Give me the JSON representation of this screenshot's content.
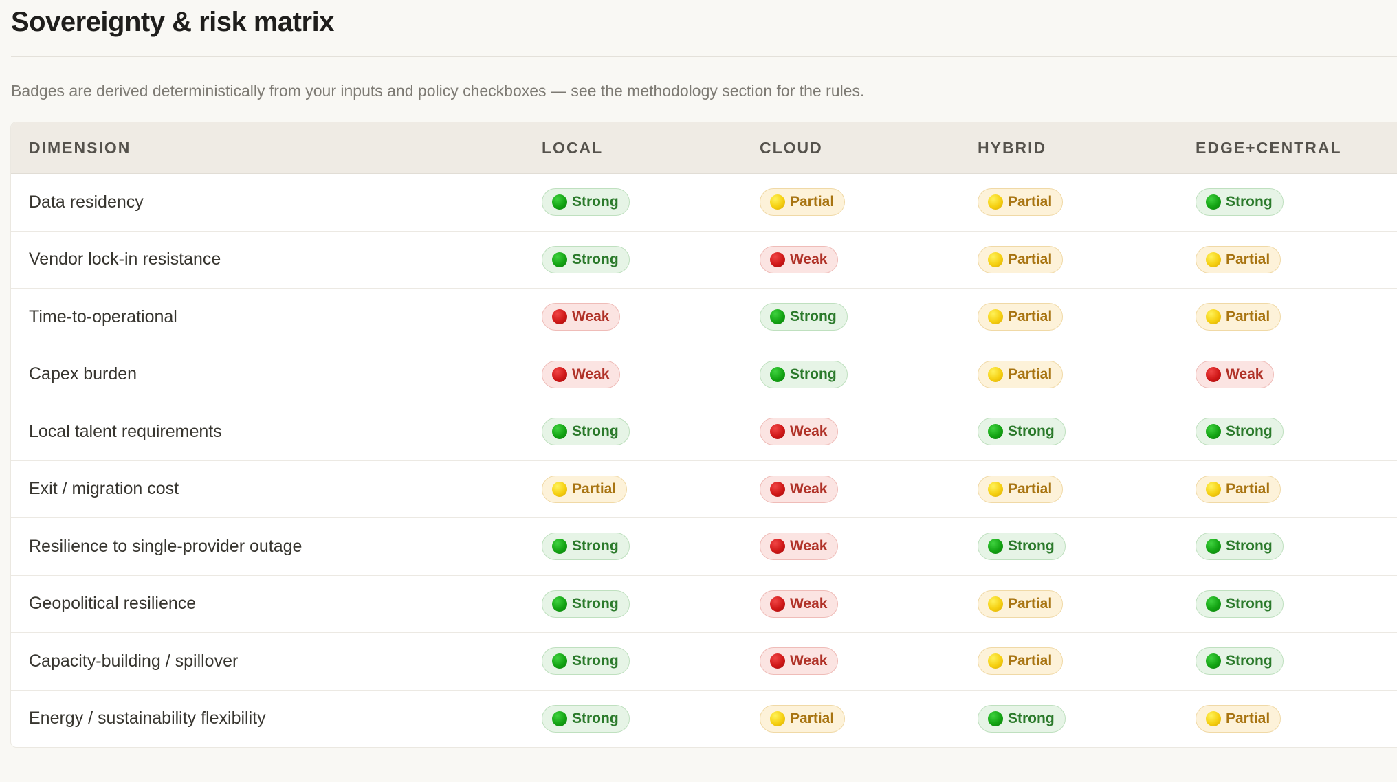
{
  "page": {
    "title": "Sovereignty & risk matrix",
    "subtitle": "Badges are derived deterministically from your inputs and policy checkboxes — see the methodology section for the rules."
  },
  "colors": {
    "strong": "#13a313",
    "partial": "#f5cf10",
    "weak": "#cf1717",
    "header_bg": "#efebe4",
    "page_bg": "#f9f8f4"
  },
  "table": {
    "columns": [
      "DIMENSION",
      "LOCAL",
      "CLOUD",
      "HYBRID",
      "EDGE+CENTRAL"
    ],
    "rows": [
      {
        "dimension": "Data residency",
        "local": "Strong",
        "cloud": "Partial",
        "hybrid": "Partial",
        "edge_central": "Strong"
      },
      {
        "dimension": "Vendor lock-in resistance",
        "local": "Strong",
        "cloud": "Weak",
        "hybrid": "Partial",
        "edge_central": "Partial"
      },
      {
        "dimension": "Time-to-operational",
        "local": "Weak",
        "cloud": "Strong",
        "hybrid": "Partial",
        "edge_central": "Partial"
      },
      {
        "dimension": "Capex burden",
        "local": "Weak",
        "cloud": "Strong",
        "hybrid": "Partial",
        "edge_central": "Weak"
      },
      {
        "dimension": "Local talent requirements",
        "local": "Strong",
        "cloud": "Weak",
        "hybrid": "Strong",
        "edge_central": "Strong"
      },
      {
        "dimension": "Exit / migration cost",
        "local": "Partial",
        "cloud": "Weak",
        "hybrid": "Partial",
        "edge_central": "Partial"
      },
      {
        "dimension": "Resilience to single-provider outage",
        "local": "Strong",
        "cloud": "Weak",
        "hybrid": "Strong",
        "edge_central": "Strong"
      },
      {
        "dimension": "Geopolitical resilience",
        "local": "Strong",
        "cloud": "Weak",
        "hybrid": "Partial",
        "edge_central": "Strong"
      },
      {
        "dimension": "Capacity-building / spillover",
        "local": "Strong",
        "cloud": "Weak",
        "hybrid": "Partial",
        "edge_central": "Strong"
      },
      {
        "dimension": "Energy / sustainability flexibility",
        "local": "Strong",
        "cloud": "Partial",
        "hybrid": "Strong",
        "edge_central": "Partial"
      }
    ]
  }
}
